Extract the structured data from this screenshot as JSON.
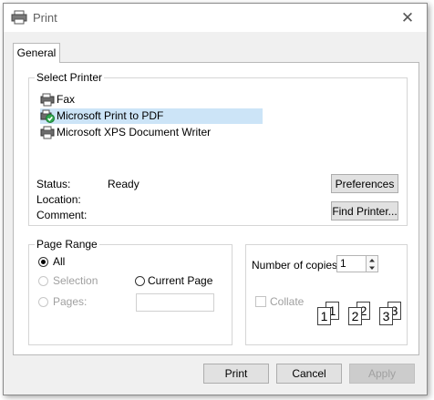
{
  "window": {
    "title": "Print",
    "close_glyph": "✕"
  },
  "tabs": [
    {
      "label": "General",
      "active": true
    }
  ],
  "select_printer": {
    "label": "Select Printer",
    "printers": [
      {
        "name": "Fax",
        "icon": "fax-printer-icon",
        "selected": false
      },
      {
        "name": "Microsoft Print to PDF",
        "icon": "default-printer-icon",
        "selected": true
      },
      {
        "name": "Microsoft XPS Document Writer",
        "icon": "printer-icon",
        "selected": false
      }
    ],
    "status_label": "Status:",
    "status_value": "Ready",
    "location_label": "Location:",
    "location_value": "",
    "comment_label": "Comment:",
    "comment_value": "",
    "preferences_button": "Preferences",
    "find_printer_button": "Find Printer..."
  },
  "page_range": {
    "label": "Page Range",
    "all_label": "All",
    "selection_label": "Selection",
    "current_page_label": "Current Page",
    "pages_label": "Pages:",
    "pages_value": "",
    "selected_option": "All"
  },
  "copies": {
    "number_label": "Number of copies:",
    "number_value": "1",
    "collate_label": "Collate",
    "collate_checked": false,
    "collate_page_numbers": [
      "1",
      "1",
      "2",
      "2",
      "3",
      "3"
    ]
  },
  "footer": {
    "print_button": "Print",
    "cancel_button": "Cancel",
    "apply_button": "Apply"
  },
  "colors": {
    "selection_highlight": "#cce4f7",
    "dialog_background": "#f0f0f0",
    "default_check": "#2fa84f"
  }
}
